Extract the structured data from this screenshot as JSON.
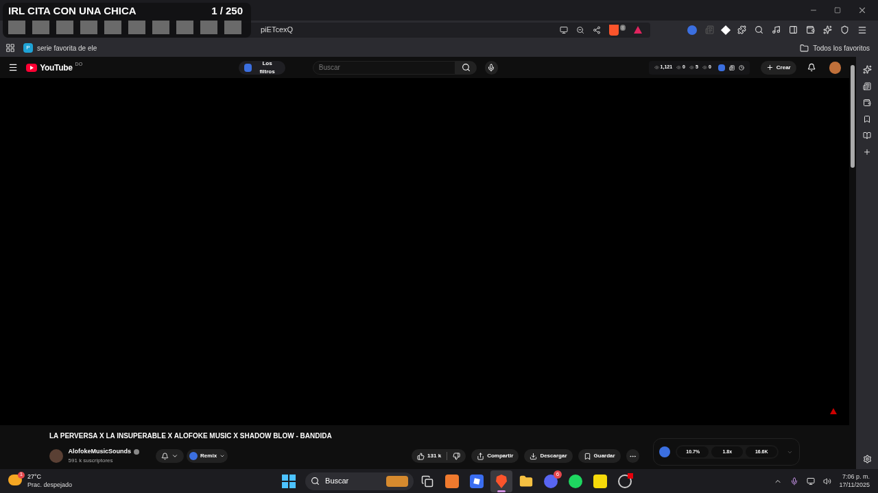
{
  "overlay": {
    "title": "IRL CITA CON UNA CHICA",
    "counter": "1 / 250"
  },
  "address": {
    "fragment": "piETcexQ",
    "shield_count": "8"
  },
  "bookmarks": [
    {
      "label": "serie favorita de ele",
      "badge": "P"
    }
  ],
  "all_bookmarks": "Todos los favoritos",
  "youtube": {
    "logo": "YouTube",
    "region": "DO",
    "filters": "Los filtros",
    "search_placeholder": "Buscar",
    "stats": [
      "1,121",
      "0",
      "5",
      "0"
    ],
    "create": "Crear"
  },
  "video": {
    "title": "LA PERVERSA X LA INSUPERABLE X ALOFOKE MUSIC X SHADOW BLOW - BANDIDA",
    "channel": "AlofokeMusicSounds",
    "subscribers": "591 k suscriptores",
    "remix": "Remix",
    "likes": "131 k",
    "actions": [
      "Compartir",
      "Descargar",
      "Guardar"
    ],
    "metrics": [
      "10.7%",
      "1.8x",
      "16.6K"
    ]
  },
  "taskbar": {
    "temperature": "27°C",
    "weather": "Prac. despejado",
    "weather_badge": "1",
    "search": "Buscar",
    "discord_badge": "6",
    "time": "7:06 p. m.",
    "date": "17/11/2025",
    "apps": [
      {
        "kind": "windows",
        "selected": false
      },
      {
        "kind": "taskview",
        "selected": false
      },
      {
        "kind": "orange",
        "selected": false
      },
      {
        "kind": "roblox",
        "selected": false
      },
      {
        "kind": "brave",
        "selected": true
      },
      {
        "kind": "folder",
        "selected": false
      },
      {
        "kind": "discord",
        "selected": false
      },
      {
        "kind": "spotify",
        "selected": false
      },
      {
        "kind": "notes",
        "selected": false
      },
      {
        "kind": "obs",
        "selected": false
      }
    ]
  }
}
